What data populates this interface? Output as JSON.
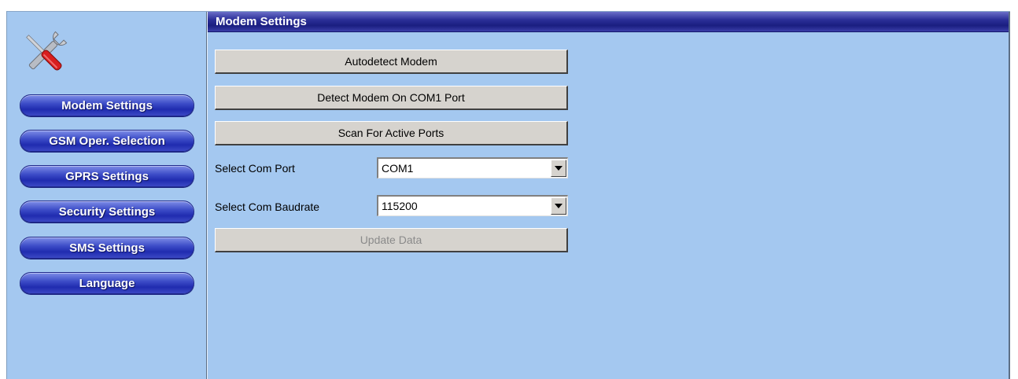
{
  "header": {
    "title": "Modem Settings"
  },
  "sidebar": {
    "icon": "tools-icon",
    "items": [
      {
        "label": "Modem Settings"
      },
      {
        "label": "GSM Oper. Selection"
      },
      {
        "label": "GPRS Settings"
      },
      {
        "label": "Security Settings"
      },
      {
        "label": "SMS Settings"
      },
      {
        "label": "Language"
      }
    ]
  },
  "main": {
    "buttons": {
      "autodetect": "Autodetect Modem",
      "detect_com1": "Detect Modem On COM1 Port",
      "scan_ports": "Scan For Active Ports",
      "update": "Update Data"
    },
    "com_port": {
      "label": "Select Com Port",
      "value": "COM1"
    },
    "baudrate": {
      "label": "Select Com Baudrate",
      "value": "115200"
    }
  },
  "colors": {
    "panel_background": "#a4c8f0",
    "nav_button": "#2a36b8",
    "header_bar": "#1f2386"
  }
}
